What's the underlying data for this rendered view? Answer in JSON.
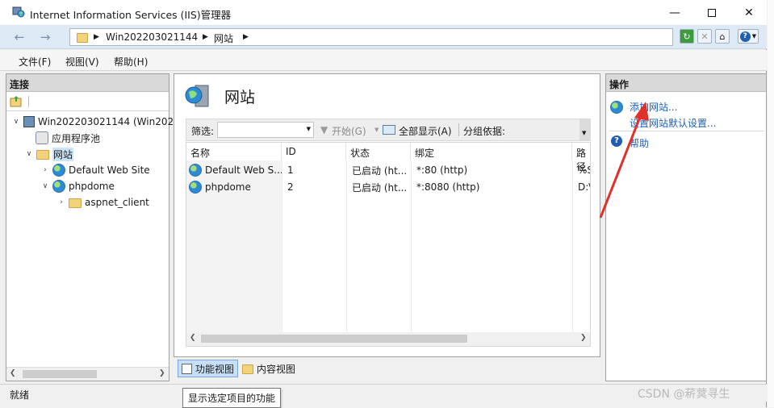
{
  "window": {
    "title": "Internet Information Services (IIS)管理器"
  },
  "address": {
    "crumbs": [
      "Win202203021144",
      "网站"
    ]
  },
  "menu": [
    "文件(F)",
    "视图(V)",
    "帮助(H)"
  ],
  "connections": {
    "header": "连接",
    "tree": [
      {
        "label": "Win202203021144 (Win202"
      },
      {
        "label": "应用程序池"
      },
      {
        "label": "网站"
      },
      {
        "label": "Default Web Site"
      },
      {
        "label": "phpdome"
      },
      {
        "label": "aspnet_client"
      }
    ]
  },
  "center": {
    "heading": "网站",
    "filter_label": "筛选:",
    "start_label": "开始(G)",
    "show_all_label": "全部显示(A)",
    "group_label": "分组依据:",
    "columns": [
      "名称",
      "ID",
      "状态",
      "绑定",
      "路径"
    ],
    "rows": [
      [
        "Default Web S...",
        "1",
        "已启动 (ht...",
        "*:80 (http)",
        "%S"
      ],
      [
        "phpdome",
        "2",
        "已启动 (ht...",
        "*:8080 (http)",
        "D:\\"
      ]
    ]
  },
  "view_tabs": {
    "feature_view": "功能视图",
    "content_view": "内容视图"
  },
  "actions": {
    "header": "操作",
    "add_site": "添加网站...",
    "set_defaults": "设置网站默认设置...",
    "help": "帮助"
  },
  "status": {
    "text": "就绪",
    "tooltip": "显示选定项目的功能"
  },
  "watermark": "CSDN @菥蓂寻生",
  "colors": {
    "accent": "#1f5fb0",
    "annotation_arrow": "#e0302a"
  }
}
